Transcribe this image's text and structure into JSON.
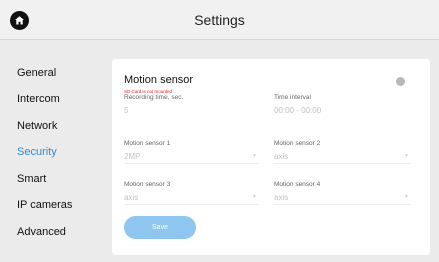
{
  "header": {
    "title": "Settings",
    "home_icon": "home-icon"
  },
  "sidebar": {
    "items": [
      {
        "label": "General"
      },
      {
        "label": "Intercom"
      },
      {
        "label": "Network"
      },
      {
        "label": "Security",
        "active": true
      },
      {
        "label": "Smart"
      },
      {
        "label": "IP cameras"
      },
      {
        "label": "Advanced"
      }
    ],
    "active_color": "#2d8cd8"
  },
  "card": {
    "title": "Motion sensor",
    "error": "SD Card is not mounted",
    "toggle_on": false,
    "fields": {
      "recording_time": {
        "label": "Recording time, sec.",
        "value": "5"
      },
      "time_interval": {
        "label": "Time interval",
        "value": "00:00 - 00:00"
      },
      "motion_sensor_1": {
        "label": "Motion sensor 1",
        "value": "2MP"
      },
      "motion_sensor_2": {
        "label": "Motion sensor 2",
        "value": "axis"
      },
      "motion_sensor_3": {
        "label": "Motion sensor 3",
        "value": "axis"
      },
      "motion_sensor_4": {
        "label": "Motion sensor 4",
        "value": "axis"
      }
    },
    "save_label": "Save"
  }
}
